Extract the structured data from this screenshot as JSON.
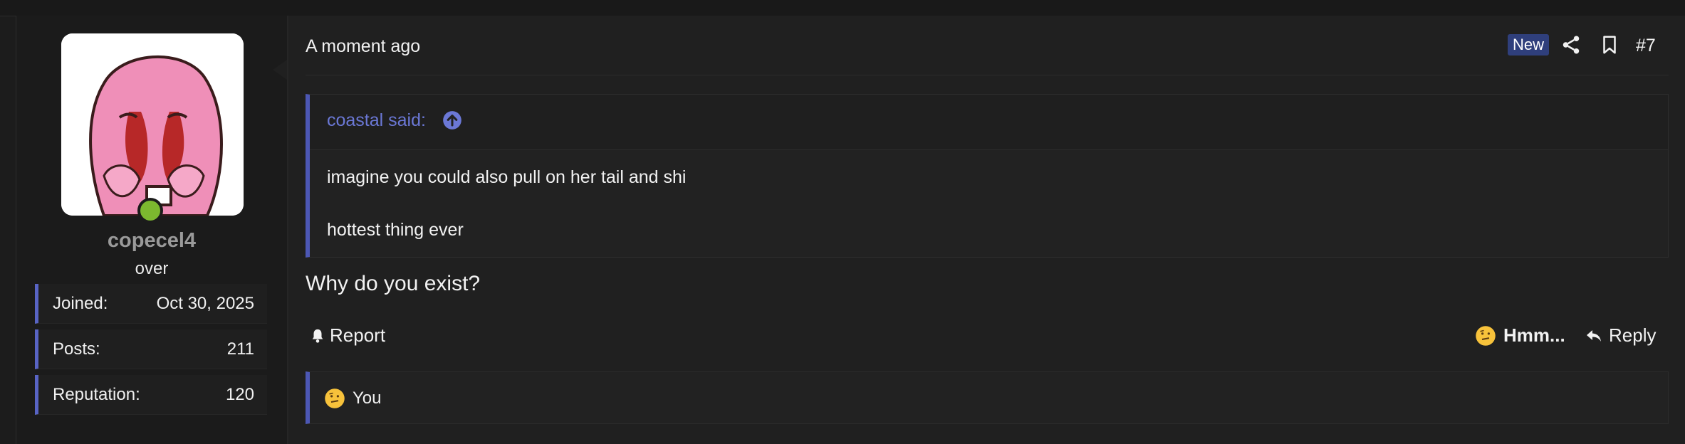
{
  "user": {
    "username": "copecel4",
    "title": "over",
    "stats": [
      {
        "label": "Joined:",
        "value": "Oct 30, 2025"
      },
      {
        "label": "Posts:",
        "value": "211"
      },
      {
        "label": "Reputation:",
        "value": "120"
      }
    ],
    "online_status_color": "#7cb82f",
    "avatar_icon": "cartoon-avatar"
  },
  "post": {
    "time": "A moment ago",
    "badge": "New",
    "number": "#7",
    "share_icon": "share-icon",
    "bookmark_icon": "bookmark-icon",
    "quote": {
      "author": "coastal said:",
      "lines": [
        "imagine you could also pull on her tail and shi",
        "hottest thing ever"
      ]
    },
    "message": "Why do you exist?",
    "actions": {
      "report": "Report",
      "reaction": "Hmm...",
      "reply": "Reply"
    },
    "reactions_by": "You"
  },
  "colors": {
    "accent": "#4c57b4",
    "link": "#6b78d6",
    "badge_bg": "#2f3f7c"
  }
}
